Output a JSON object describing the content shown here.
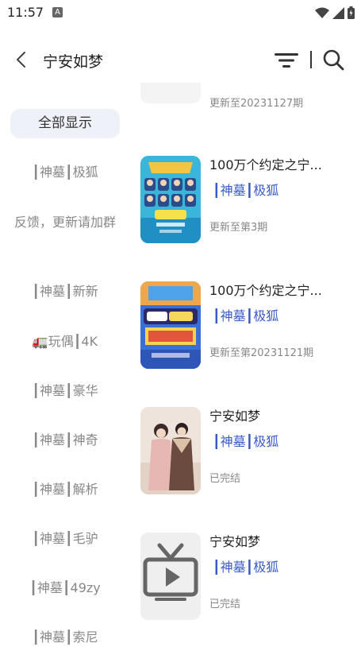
{
  "status_bar": {
    "time": "11:57",
    "notif_letter": "A"
  },
  "header": {
    "title": "宁安如梦"
  },
  "sidebar": {
    "items": [
      {
        "label": "全部显示",
        "active": true
      },
      {
        "label": "┃神墓┃极狐"
      },
      {
        "label": "反馈，更新请加群"
      },
      {
        "label": "┃神墓┃新新"
      },
      {
        "label": "🚛玩偶┃4K"
      },
      {
        "label": "┃神墓┃豪华"
      },
      {
        "label": "┃神墓┃神奇"
      },
      {
        "label": "┃神墓┃解析"
      },
      {
        "label": "┃神墓┃毛驴"
      },
      {
        "label": "┃神墓┃49zy"
      },
      {
        "label": "┃神墓┃索尼"
      }
    ]
  },
  "results": {
    "clipped_top_status": "更新至20231127期",
    "items": [
      {
        "title": "100万个约定之宁...",
        "source": "┃神墓┃极狐",
        "status": "更新至第3期"
      },
      {
        "title": "100万个约定之宁...",
        "source": "┃神墓┃极狐",
        "status": "更新至第20231121期"
      },
      {
        "title": "宁安如梦",
        "source": "┃神墓┃极狐",
        "status": "已完结"
      },
      {
        "title": "宁安如梦",
        "source": "┃神墓┃极狐",
        "status": "已完结"
      }
    ]
  },
  "colors": {
    "accent_blue": "#3a5bc7",
    "sidebar_active_bg": "#eef1f7",
    "muted_text": "#888888"
  }
}
